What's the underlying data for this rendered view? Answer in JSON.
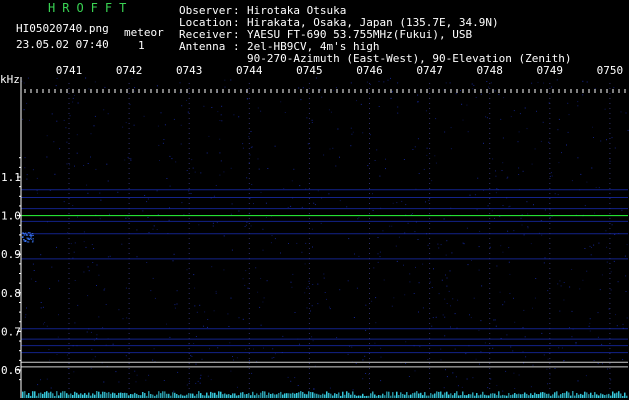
{
  "header": {
    "app_title": "HROFFT",
    "filename": "HI05020740.png",
    "timestamp": "23.05.02 07:40",
    "meteor_label": "meteor",
    "meteor_count": "1"
  },
  "station": {
    "observer_label": "Observer",
    "observer": "Hirotaka Otsuka",
    "location_label": "Location",
    "location": "Hirakata, Osaka, Japan (135.7E, 34.9N)",
    "receiver_label": "Receiver",
    "receiver": "YAESU FT-690 53.755MHz(Fukui), USB",
    "antenna_label": "Antenna",
    "antenna_line1": "2el-HB9CV, 4m's high",
    "antenna_line2": "90-270-Azimuth (East-West), 90-Elevation (Zenith)",
    "separator": ":"
  },
  "chart_data": {
    "type": "heatmap",
    "ylabel": "kHz",
    "y_ticks": [
      "1.1",
      "1.0",
      "0.9",
      "0.8",
      "0.7",
      "0.6"
    ],
    "x_ticks": [
      "0741",
      "0742",
      "0743",
      "0744",
      "0745",
      "0746",
      "0747",
      "0748",
      "0749",
      "0750"
    ],
    "ylim": [
      0.57,
      1.19
    ],
    "carrier_lines_khz": [
      1.0,
      0.62,
      0.608
    ],
    "faint_lines_khz": [
      1.067,
      1.047,
      1.018,
      0.985,
      0.953,
      0.888,
      0.707,
      0.68,
      0.663,
      0.645
    ],
    "colors": {
      "background": "#000000",
      "axis_text": "#ffffff",
      "title": "#39d353",
      "carrier": "#2aff3a",
      "reference": "#cfcfcf",
      "noise": "#1a2fb8",
      "baseline_noise": "#3ad4e8"
    }
  }
}
